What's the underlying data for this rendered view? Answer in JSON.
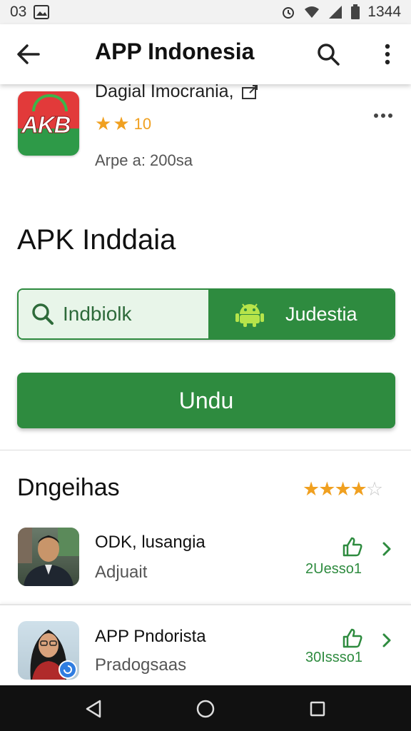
{
  "status_bar": {
    "left_text": "03",
    "right_text": "1344"
  },
  "app_bar": {
    "title": "APP Indonesia",
    "icons": [
      "back-arrow-icon",
      "search-icon",
      "more-vertical-icon"
    ]
  },
  "app_header": {
    "logo_text": "AKB",
    "name": "Dagial Imocrania,",
    "rating_stars": 2,
    "rating_value": "10",
    "meta": "Arpe a: 200sa"
  },
  "section": {
    "title": "APK Inddaia"
  },
  "split_bar": {
    "left_label": "Indbiolk",
    "right_label": "Judestia"
  },
  "download": {
    "label": "Undu"
  },
  "reviews": {
    "title": "Dngeihas",
    "stars_filled": 4,
    "stars_total": 5,
    "items": [
      {
        "name": "ODK, lusangia",
        "subtitle": "Adjuait",
        "count": "2Uesso1"
      },
      {
        "name": "APP Pndorista",
        "subtitle": "Pradogsaas",
        "count": "30Issso1"
      }
    ]
  },
  "colors": {
    "primary_green": "#2e8b3f",
    "light_green": "#e8f5e9",
    "star_orange": "#f0a020",
    "nav_black": "#111111"
  }
}
